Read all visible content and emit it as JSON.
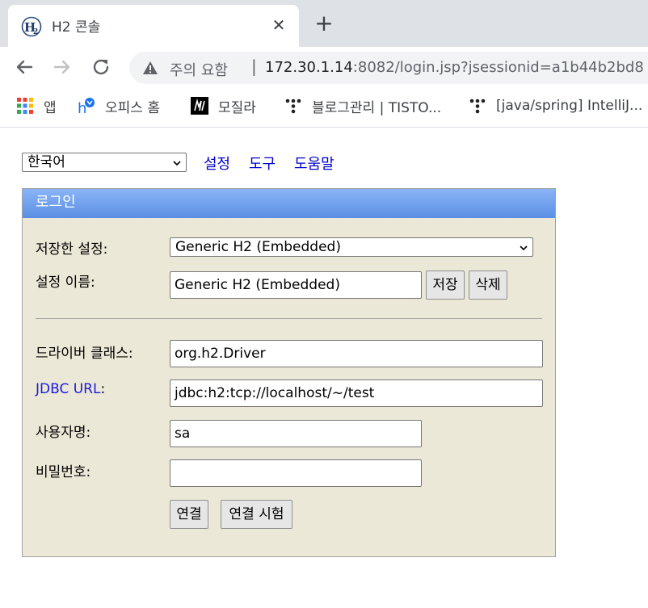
{
  "browser": {
    "tab": {
      "title": "H2 콘솔",
      "close_glyph": "✕",
      "favicon": "h2-logo-icon"
    },
    "new_tab_glyph": "+",
    "omnibox": {
      "security_label": "주의 요함",
      "separator": "|",
      "url_host": "172.30.1.14",
      "url_rest": ":8082/login.jsp?jsessionid=a1b44b2bd8"
    },
    "bookmarks": [
      {
        "label": "앱",
        "icon": "apps-grid-icon"
      },
      {
        "label": "오피스 홈",
        "icon": "office-icon"
      },
      {
        "label": "모질라",
        "icon": "mozilla-icon"
      },
      {
        "label": "블로그관리 | TISTO...",
        "icon": "tistory-icon"
      },
      {
        "label": "[java/spring] IntelliJ...",
        "icon": "tistory-icon"
      }
    ]
  },
  "page": {
    "language_select": {
      "value": "한국어"
    },
    "links": {
      "settings": "설정",
      "tools": "도구",
      "help": "도움말"
    },
    "login": {
      "header": "로그인",
      "saved_settings_label": "저장한 설정:",
      "saved_settings_value": "Generic H2 (Embedded)",
      "setting_name_label": "설정 이름:",
      "setting_name_value": "Generic H2 (Embedded)",
      "save_button": "저장",
      "delete_button": "삭제",
      "driver_class_label": "드라이버 클래스:",
      "driver_class_value": "org.h2.Driver",
      "jdbc_url_label": "JDBC URL",
      "jdbc_url_colon": ":",
      "jdbc_url_value": "jdbc:h2:tcp://localhost/~/test",
      "username_label": "사용자명:",
      "username_value": "sa",
      "password_label": "비밀번호:",
      "password_value": "",
      "connect_button": "연결",
      "test_connection_button": "연결 시험"
    }
  },
  "colors": {
    "link": "#0000cc",
    "panel_bg": "#ece8d8",
    "header_gradient_top": "#8ab4f8",
    "header_gradient_bottom": "#5b8fe3"
  }
}
